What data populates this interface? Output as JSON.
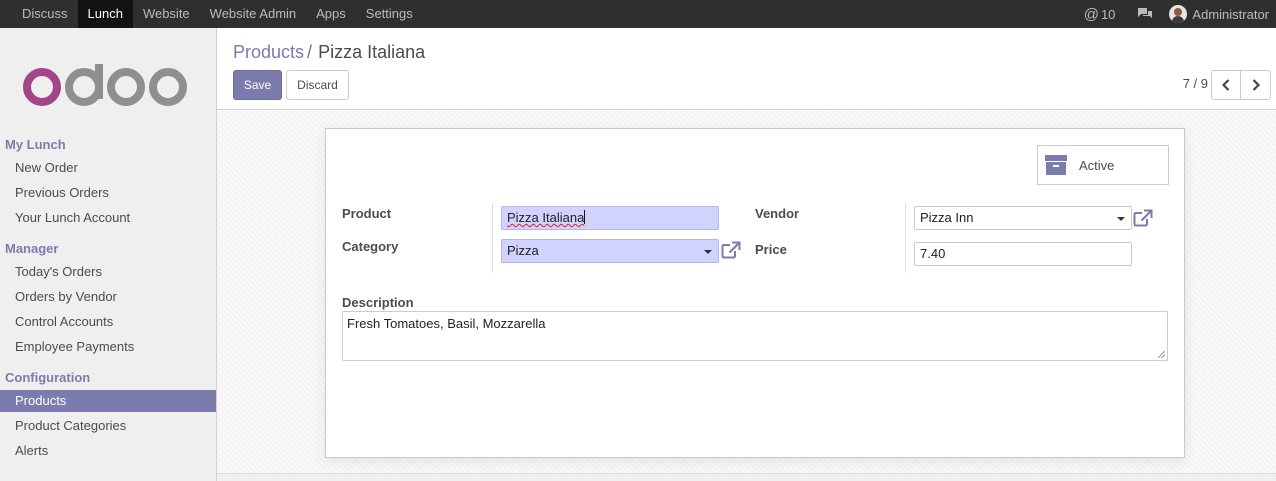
{
  "topbar": {
    "menu": [
      "Discuss",
      "Lunch",
      "Website",
      "Website Admin",
      "Apps",
      "Settings"
    ],
    "active_menu": "Lunch",
    "mention_count": "10",
    "user": "Administrator",
    "icons": [
      "at-icon",
      "chat-icon",
      "avatar"
    ]
  },
  "sidebar": {
    "logo_text": "odoo",
    "sections": [
      {
        "title": "My Lunch",
        "items": [
          "New Order",
          "Previous Orders",
          "Your Lunch Account"
        ]
      },
      {
        "title": "Manager",
        "items": [
          "Today's Orders",
          "Orders by Vendor",
          "Control Accounts",
          "Employee Payments"
        ]
      },
      {
        "title": "Configuration",
        "items": [
          "Products",
          "Product Categories",
          "Alerts"
        ]
      }
    ],
    "active_item": "Products"
  },
  "control_panel": {
    "breadcrumb_parent": "Products",
    "breadcrumb_separator": "/",
    "breadcrumb_current": "Pizza Italiana",
    "save_label": "Save",
    "discard_label": "Discard",
    "pager": "7 / 9"
  },
  "form": {
    "active_button_label": "Active",
    "product_label": "Product",
    "product_value": "Pizza Italiana",
    "category_label": "Category",
    "category_value": "Pizza",
    "vendor_label": "Vendor",
    "vendor_value": "Pizza Inn",
    "price_label": "Price",
    "price_value": "7.40",
    "description_label": "Description",
    "description_value": "Fresh Tomatoes, Basil, Mozzarella"
  },
  "colors": {
    "brand": "#7c7bad",
    "topbar": "#2f2f2f",
    "required_field": "#d2d2ff",
    "logo_o": "#a24689",
    "logo_gray": "#8f8f8f"
  }
}
